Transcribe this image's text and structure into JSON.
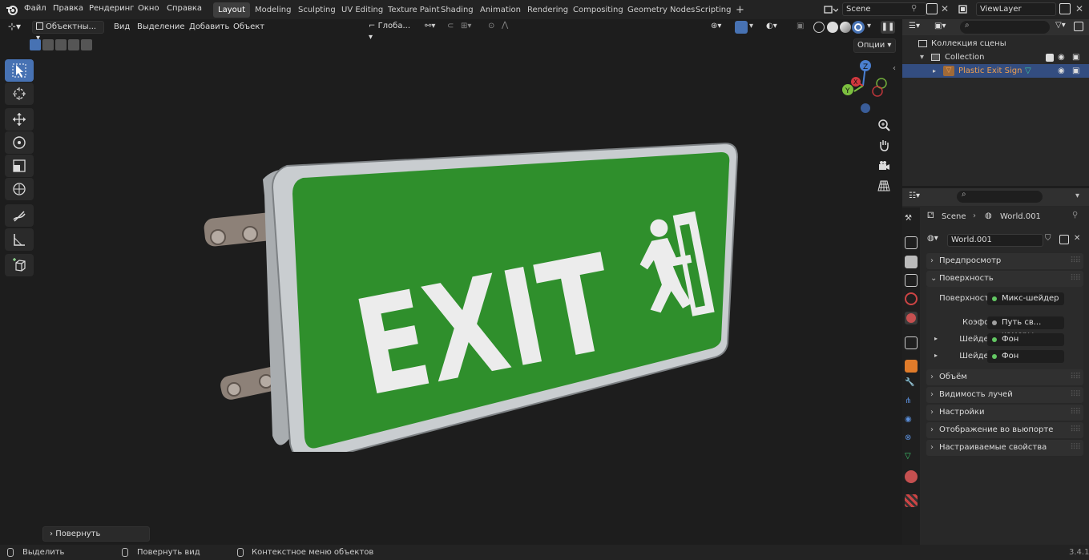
{
  "top_menu": {
    "items": [
      "Файл",
      "Правка",
      "Рендеринг",
      "Окно",
      "Справка"
    ]
  },
  "workspaces": {
    "tabs": [
      "Layout",
      "Modeling",
      "Sculpting",
      "UV Editing",
      "Texture Paint",
      "Shading",
      "Animation",
      "Rendering",
      "Compositing",
      "Geometry Nodes",
      "Scripting"
    ],
    "add_tab": "+",
    "active": "Layout"
  },
  "scene_selector": {
    "value": "Scene"
  },
  "viewlayer_selector": {
    "value": "ViewLayer"
  },
  "viewport_header": {
    "mode": "Объектны...",
    "menus": [
      "Вид",
      "Выделение",
      "Добавить",
      "Объект"
    ],
    "orientation": "Глоба...",
    "options_label": "Опции"
  },
  "scene_object": {
    "sign_text": "EXIT",
    "sign_color": "#2f8f2c",
    "frame_color": "#cfd3d6"
  },
  "gizmo": {
    "z": "Z",
    "y": "Y",
    "x": "X"
  },
  "operator_panel": {
    "label": "Повернуть"
  },
  "outliner": {
    "scene_collection": "Коллекция сцены",
    "collection": "Collection",
    "object": "Plastic Exit Sign"
  },
  "properties": {
    "breadcrumb_scene": "Scene",
    "breadcrumb_world": "World.001",
    "world_name": "World.001",
    "panels": {
      "preview": "Предпросмотр",
      "surface": "Поверхность",
      "volume": "Объём",
      "ray_visibility": "Видимость лучей",
      "settings": "Настройки",
      "viewport_display": "Отображение во вьюпорте",
      "custom_props": "Настраиваемые свойства"
    },
    "surface_label": "Поверхность",
    "surface_value": "Микс-шейдер",
    "fac_label": "Коэфф.",
    "fac_value": "Путь св... камеры",
    "shader1_label": "Шейдер",
    "shader1_value": "Фон",
    "shader2_label": "Шейдер",
    "shader2_value": "Фон"
  },
  "statusbar": {
    "select": "Выделить",
    "rotate_view": "Повернуть вид",
    "context_menu": "Контекстное меню объектов",
    "version": "3.4.1"
  },
  "colors": {
    "accent": "#4772b3",
    "selected_row": "#334d80",
    "object_name": "#f0a050"
  }
}
